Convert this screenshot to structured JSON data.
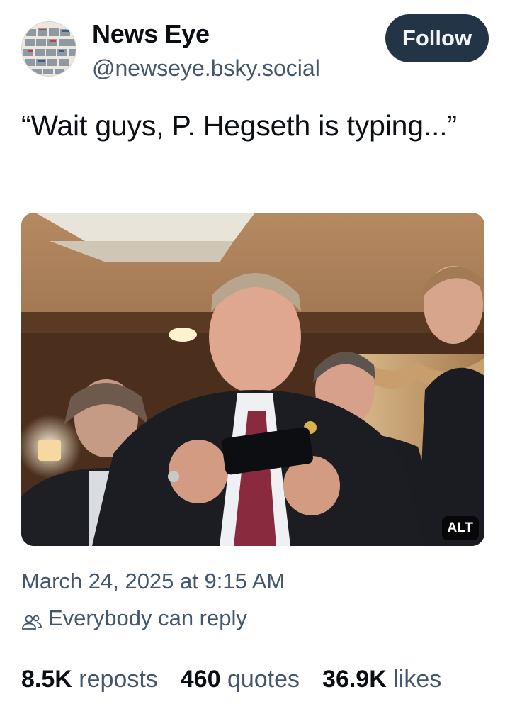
{
  "post": {
    "author": {
      "display_name": "News Eye",
      "handle": "@newseye.bsky.social",
      "avatar_icon": "newspaper-collage-avatar"
    },
    "follow_label": "Follow",
    "text": "“Wait guys, P. Hegseth is typing...”",
    "image": {
      "alt_badge": "ALT"
    },
    "timestamp": "March 24, 2025 at 9:15 AM",
    "reply_setting": {
      "icon": "people-icon",
      "label": "Everybody can reply"
    },
    "stats": [
      {
        "value": "8.5K",
        "label": "reposts"
      },
      {
        "value": "460",
        "label": "quotes"
      },
      {
        "value": "36.9K",
        "label": "likes"
      }
    ]
  },
  "colors": {
    "text_primary": "#0b0f14",
    "text_secondary": "#42576c",
    "follow_button_bg": "#243447",
    "divider": "#e3e8ed"
  }
}
